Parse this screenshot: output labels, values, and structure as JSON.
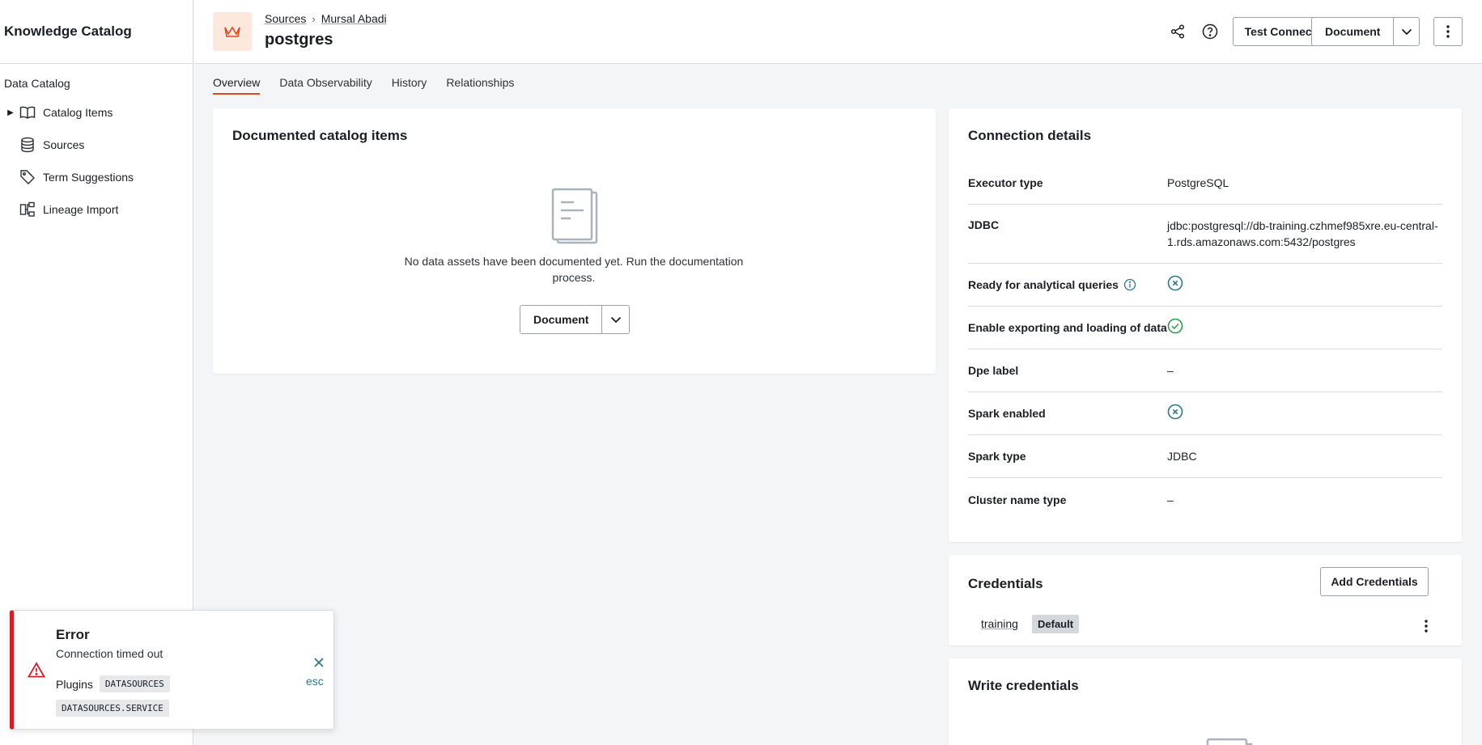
{
  "app": {
    "title": "Knowledge Catalog"
  },
  "sidebar": {
    "section": "Data Catalog",
    "items": [
      {
        "label": "Catalog Items",
        "icon": "book-icon",
        "expandable": true
      },
      {
        "label": "Sources",
        "icon": "database-icon"
      },
      {
        "label": "Term Suggestions",
        "icon": "tag-icon"
      },
      {
        "label": "Lineage Import",
        "icon": "lineage-icon"
      }
    ]
  },
  "header": {
    "breadcrumb": [
      "Sources",
      "Mursal Abadi"
    ],
    "title": "postgres",
    "test_connection": "Test Connection",
    "document": "Document"
  },
  "tabs": [
    "Overview",
    "Data Observability",
    "History",
    "Relationships"
  ],
  "documented": {
    "title": "Documented catalog items",
    "empty_text": "No data assets have been documented yet. Run the documentation process.",
    "document_button": "Document"
  },
  "connection": {
    "title": "Connection details",
    "rows": [
      {
        "label": "Executor type",
        "value": "PostgreSQL"
      },
      {
        "label": "JDBC",
        "value": "jdbc:postgresql://db-training.czhmef985xre.eu-central-1.rds.amazonaws.com:5432/postgres"
      },
      {
        "label": "Ready for analytical queries",
        "status": "no"
      },
      {
        "label": "Enable exporting and loading of data",
        "status": "yes"
      },
      {
        "label": "Dpe label",
        "value": "–"
      },
      {
        "label": "Spark enabled",
        "status": "no"
      },
      {
        "label": "Spark type",
        "value": "JDBC"
      },
      {
        "label": "Cluster name type",
        "value": "–"
      }
    ]
  },
  "credentials": {
    "title": "Credentials",
    "add_button": "Add Credentials",
    "items": [
      {
        "name": "training",
        "badge": "Default"
      }
    ]
  },
  "write_credentials": {
    "title": "Write credentials"
  },
  "toast": {
    "title": "Error",
    "message": "Connection timed out",
    "plugins_label": "Plugins",
    "chips": [
      "DATASOURCES",
      "DATASOURCES.SERVICE"
    ],
    "esc": "esc"
  },
  "colors": {
    "accent": "#d94a1e",
    "error": "#d41e2a",
    "success": "#2e9e4f",
    "teal": "#2c7a8c"
  }
}
